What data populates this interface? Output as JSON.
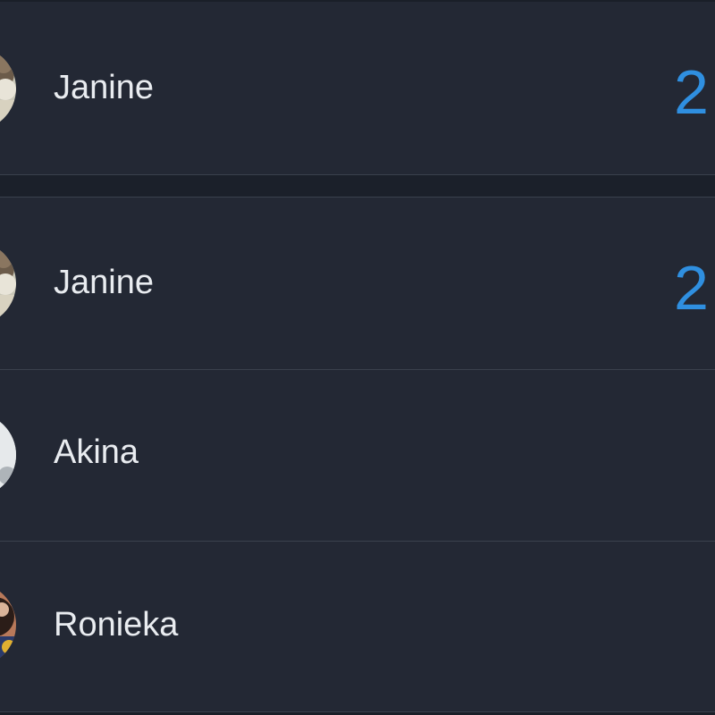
{
  "leaderboard": {
    "rows": [
      {
        "name": "Janine",
        "score": "2",
        "avatar_icon": "user-photo-janine"
      },
      {
        "name": "Janine",
        "score": "2",
        "avatar_icon": "user-photo-janine"
      },
      {
        "name": "Akina",
        "score": "",
        "avatar_icon": "user-photo-akina"
      },
      {
        "name": "Ronieka",
        "score": "",
        "avatar_icon": "user-photo-ronieka"
      }
    ]
  },
  "colors": {
    "background": "#222833",
    "row_background": "#232834",
    "divider": "#3a414d",
    "section_gap": "#1b202a",
    "name_text": "#e9ecf0",
    "score_accent": "#2f8fe0"
  }
}
